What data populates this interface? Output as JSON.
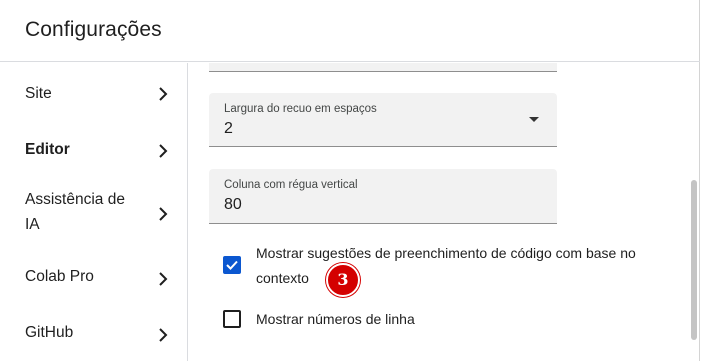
{
  "dialog": {
    "title": "Configurações"
  },
  "sidebar": {
    "items": [
      {
        "label": "Site"
      },
      {
        "label": "Editor"
      },
      {
        "label": "Assistência de IA"
      },
      {
        "label": "Colab Pro"
      },
      {
        "label": "GitHub"
      }
    ]
  },
  "editor": {
    "indent_width": {
      "label": "Largura do recuo em espaços",
      "value": "2"
    },
    "ruler_column": {
      "label": "Coluna com régua vertical",
      "value": "80"
    },
    "options": [
      {
        "label": "Mostrar sugestões de preenchimento de código com base no contexto",
        "checked": true
      },
      {
        "label": "Mostrar números de linha",
        "checked": false
      }
    ]
  },
  "badge": {
    "text": "3"
  },
  "colors": {
    "accent": "#0b57d0",
    "badge": "#d40000"
  }
}
